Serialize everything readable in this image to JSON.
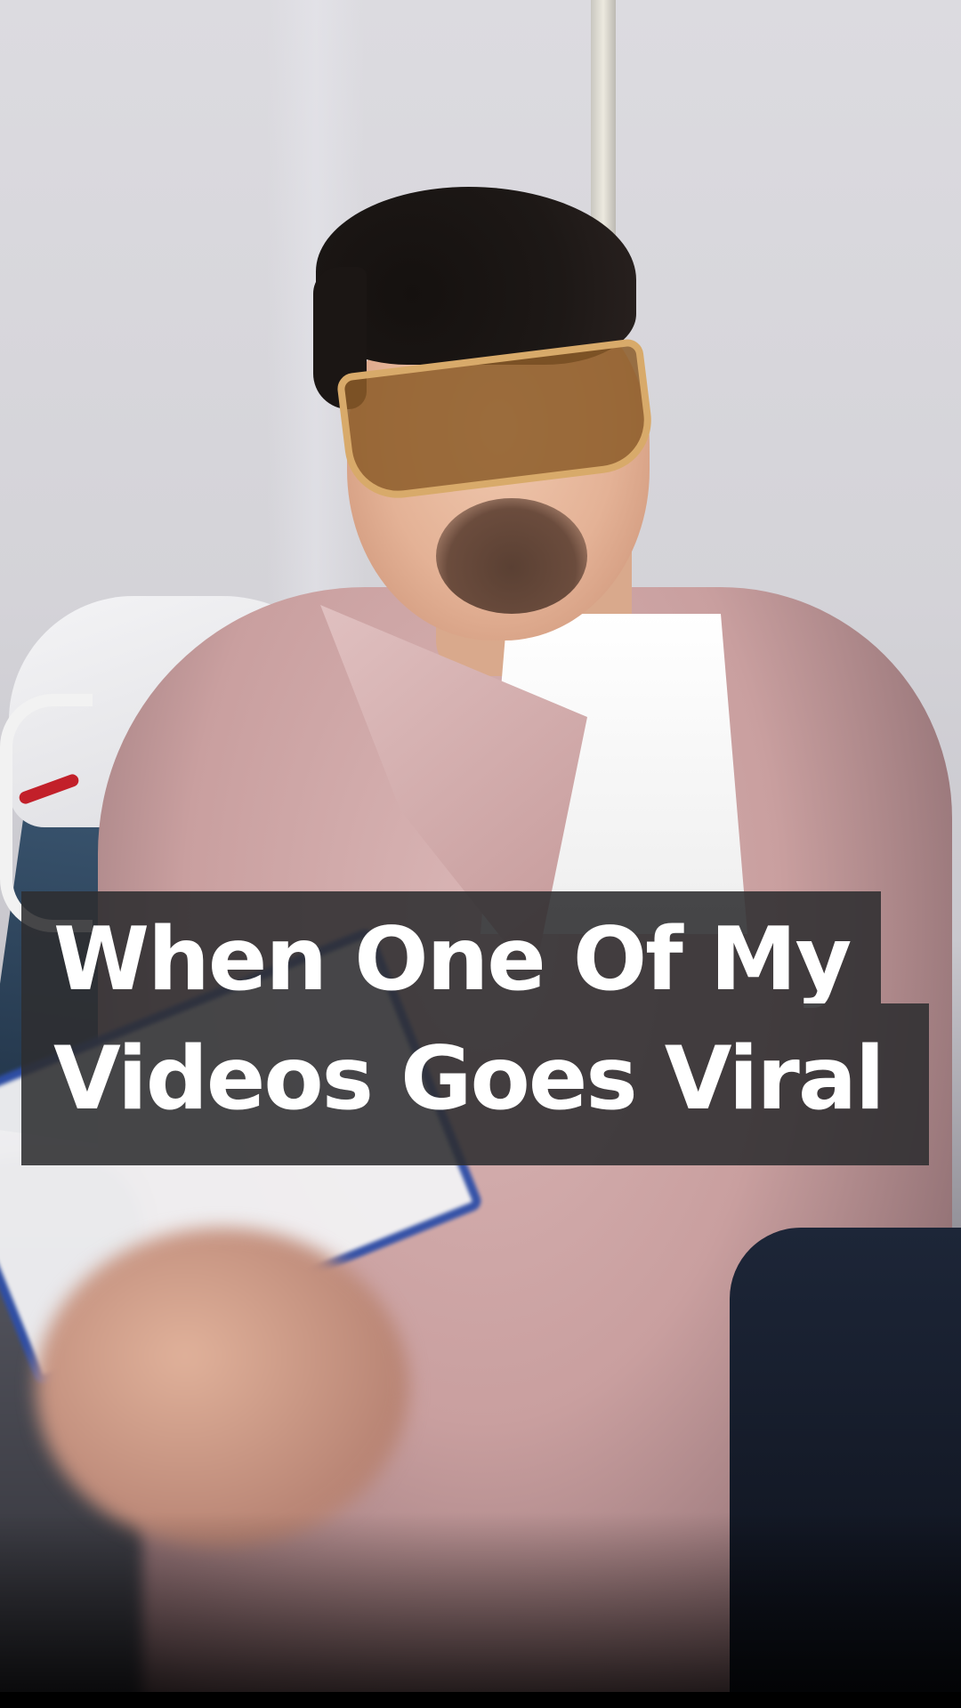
{
  "video": {
    "caption_line_1": "When One Of My",
    "caption_line_2": "Videos Goes Viral"
  },
  "colors": {
    "caption_background": "#2d2d30",
    "caption_text": "#ffffff",
    "jacket": "#c99f9f",
    "clipboard_border": "#2f4fa8"
  }
}
